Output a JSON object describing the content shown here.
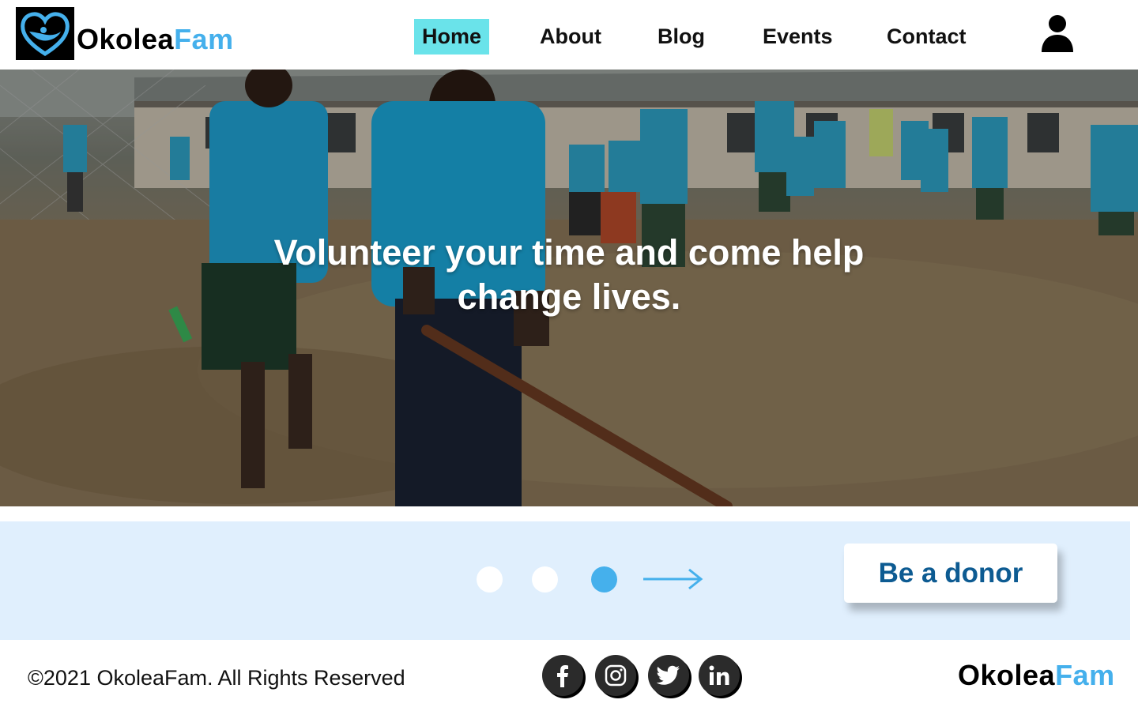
{
  "brand": {
    "name_part1": "Okolea",
    "name_part2": "Fam",
    "accent_color": "#45b0ec"
  },
  "nav": {
    "items": [
      {
        "label": "Home",
        "active": true
      },
      {
        "label": "About",
        "active": false
      },
      {
        "label": "Blog",
        "active": false
      },
      {
        "label": "Events",
        "active": false
      },
      {
        "label": "Contact",
        "active": false
      }
    ],
    "active_color": "#6ae3ea",
    "user_icon": "user-icon"
  },
  "hero": {
    "title": "Volunteer your time and come help change lives.",
    "image": "volunteers-hoeing-schoolyard-photo"
  },
  "slider": {
    "slide_count": 3,
    "active_index": 2,
    "next_icon": "arrow-right-icon"
  },
  "cta": {
    "label": "Be a donor",
    "text_color": "#0d5b92"
  },
  "footer": {
    "copyright": "©2021 OkoleaFam. All Rights Reserved",
    "social": [
      "facebook-icon",
      "instagram-icon",
      "twitter-icon",
      "linkedin-icon"
    ],
    "brand_part1": "Okolea",
    "brand_part2": "Fam"
  },
  "colors": {
    "band_background": "#e0effd",
    "cta_background": "#ffffff"
  }
}
